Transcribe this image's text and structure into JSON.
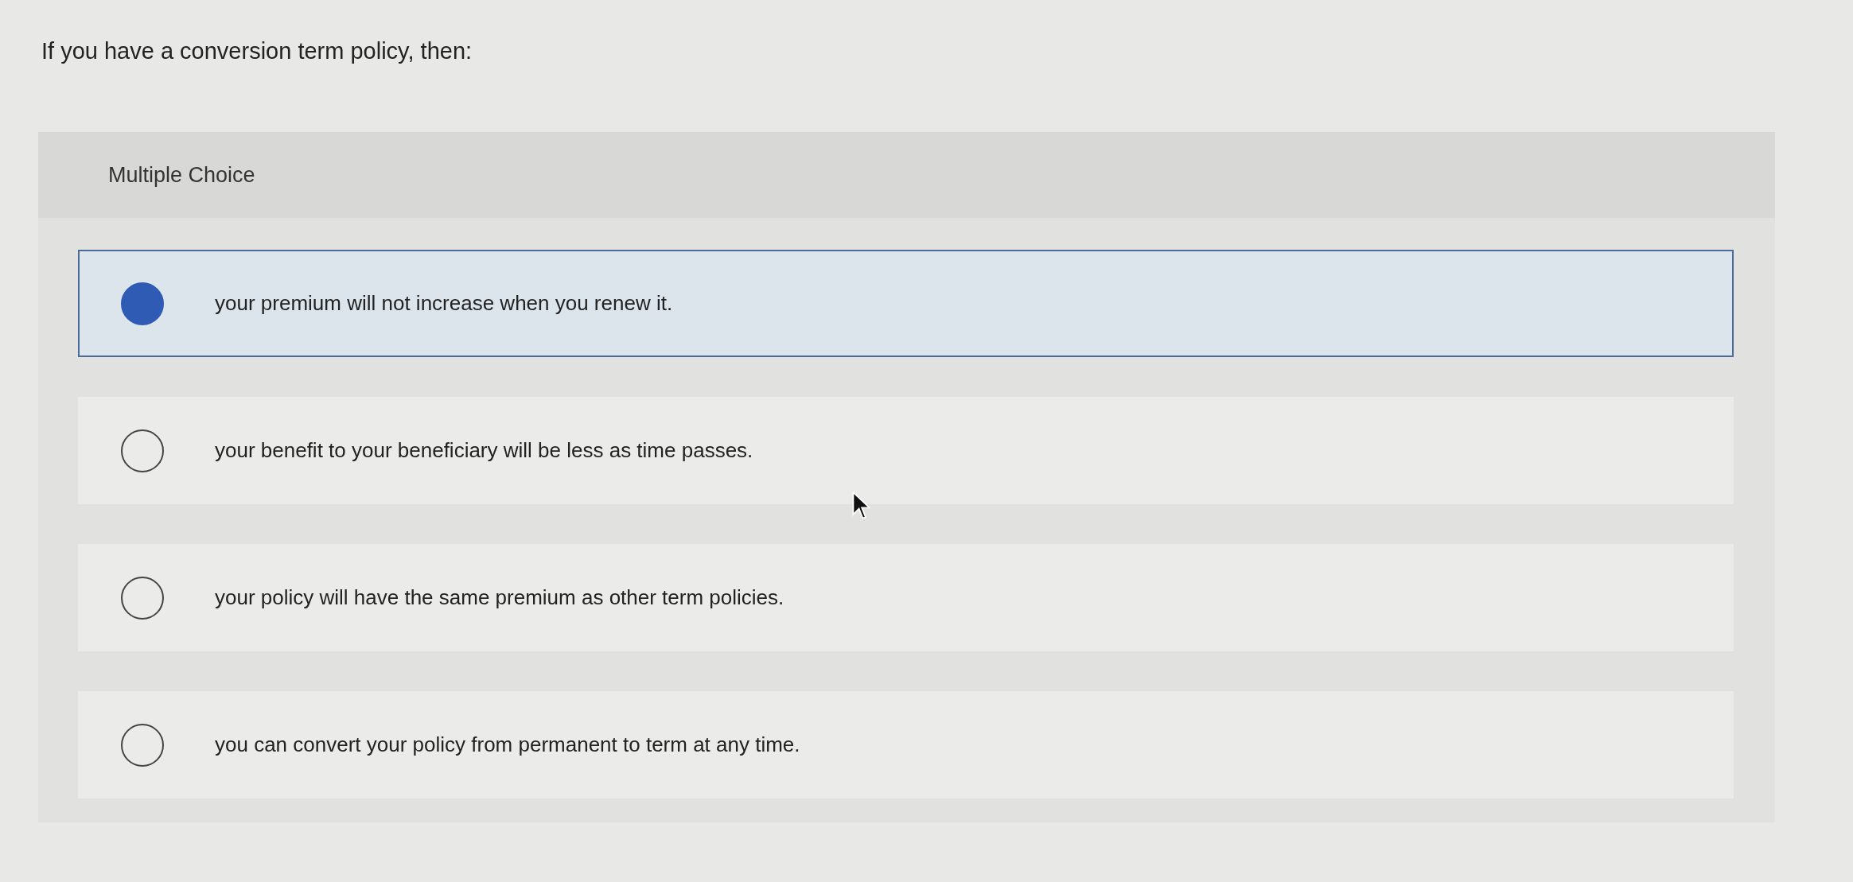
{
  "question": "If you have a conversion term policy, then:",
  "panel": {
    "heading": "Multiple Choice"
  },
  "options": [
    {
      "label": "your premium will not increase when you renew it.",
      "selected": true
    },
    {
      "label": "your benefit to your beneficiary will be less as time passes.",
      "selected": false
    },
    {
      "label": "your policy will have the same premium as other term policies.",
      "selected": false
    },
    {
      "label": "you can convert your policy from permanent to term at any time.",
      "selected": false
    }
  ]
}
